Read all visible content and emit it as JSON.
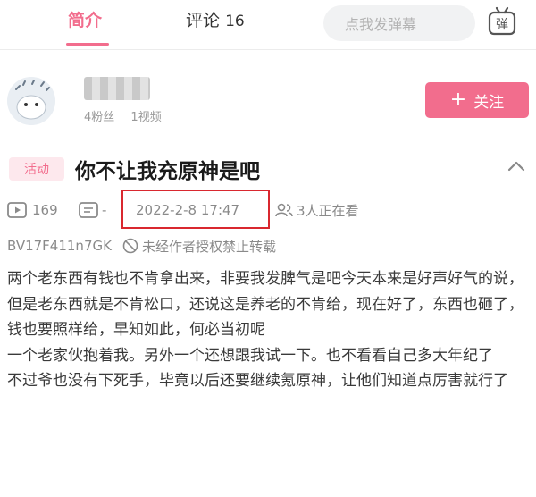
{
  "tabs": {
    "intro_label": "简介",
    "comments_label": "评论",
    "comments_count": "16"
  },
  "danmaku": {
    "placeholder": "点我发弹幕",
    "toggle_label": "弹"
  },
  "uploader": {
    "fans": "4粉丝",
    "videos": "1视频"
  },
  "follow_button": {
    "icon": "+",
    "label": "关注"
  },
  "video": {
    "badge": "活动",
    "title": "你不让我充原神是吧",
    "play_count": "169",
    "danmaku_count": "-",
    "publish_time": "2022-2-8 17:47",
    "viewers": "3人正在看",
    "bvid": "BV17F411n7GK",
    "copyright_notice": "未经作者授权禁止转载"
  },
  "description": [
    "两个老东西有钱也不肯拿出来，非要我发脾气是吧今天本来是好声好气的说，但是老东西就是不肯松口，还说这是养老的不肯给，现在好了，东西也砸了，钱也要照样给，早知如此，何必当初呢",
    "一个老家伙抱着我。另外一个还想跟我试一下。也不看看自己多大年纪了",
    "不过爷也没有下死手，毕竟以后还要继续氪原神，让他们知道点厉害就行了"
  ],
  "colors": {
    "accent": "#f26d8d",
    "highlight_box": "#d9282f",
    "muted_text": "#8a8a8a"
  },
  "icons": {
    "danmaku_toggle": "danmaku-toggle-icon",
    "collapse": "chevron-up-icon",
    "play": "play-icon",
    "danmaku": "danmaku-icon",
    "viewers": "viewers-icon",
    "ban": "ban-icon"
  }
}
